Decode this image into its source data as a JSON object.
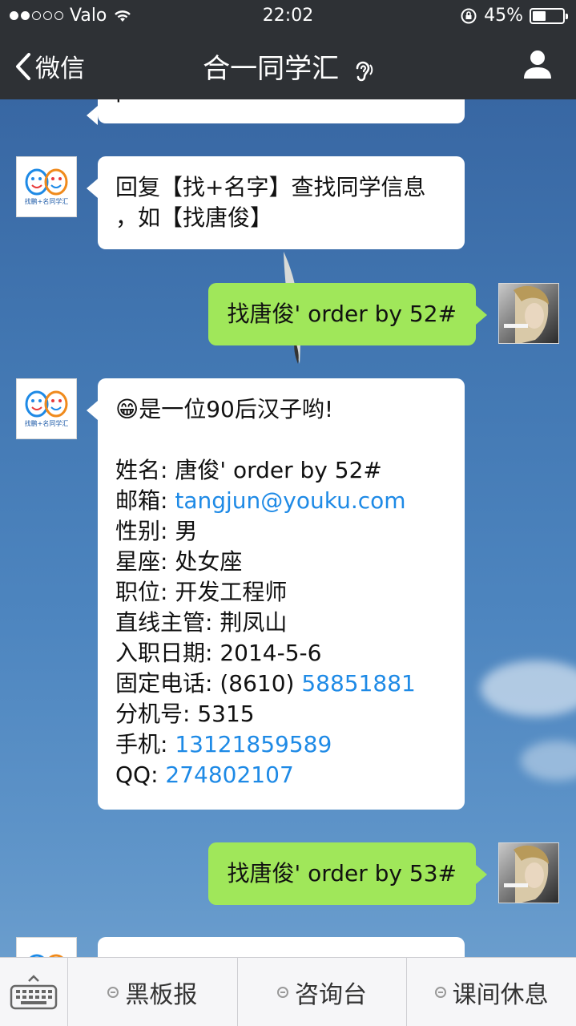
{
  "status": {
    "carrier": "Valo",
    "time": "22:02",
    "battery": "45%",
    "battery_level": 0.45
  },
  "nav": {
    "back_label": "微信",
    "title": "合一同学汇"
  },
  "messages": {
    "m0_partial": "'",
    "m1": {
      "line1": "回复【找+名字】查找同学信息",
      "line2": "，如【找唐俊】"
    },
    "m2": "找唐俊' order by 52#",
    "m3": {
      "emoji": "😁",
      "headline": "是一位90后汉子哟!",
      "fields": [
        {
          "label": "姓名:",
          "value": "唐俊' order by 52#"
        },
        {
          "label": "邮箱:",
          "value": "tangjun@youku.com"
        },
        {
          "label": "性别:",
          "value": "男"
        },
        {
          "label": "星座:",
          "value": "处女座"
        },
        {
          "label": "职位:",
          "value": "开发工程师"
        },
        {
          "label": "直线主管:",
          "value": "荆凤山"
        },
        {
          "label": "入职日期:",
          "value": "2014-5-6"
        },
        {
          "label": "固定电话:",
          "prefix": "(8610)",
          "value": "58851881"
        },
        {
          "label": "分机号:",
          "value": "5315"
        },
        {
          "label": "手机:",
          "value": "13121859589"
        },
        {
          "label": "QQ:",
          "value": "274802107"
        }
      ]
    },
    "m4": "找唐俊' order by 53#"
  },
  "bottom_menu": [
    "黑板报",
    "咨询台",
    "课间休息"
  ],
  "logo_text": "找鹏+名同学汇",
  "colors": {
    "nav_bg": "#2e3135",
    "out_bubble": "#a0e75a",
    "link": "#1e8ae6"
  }
}
